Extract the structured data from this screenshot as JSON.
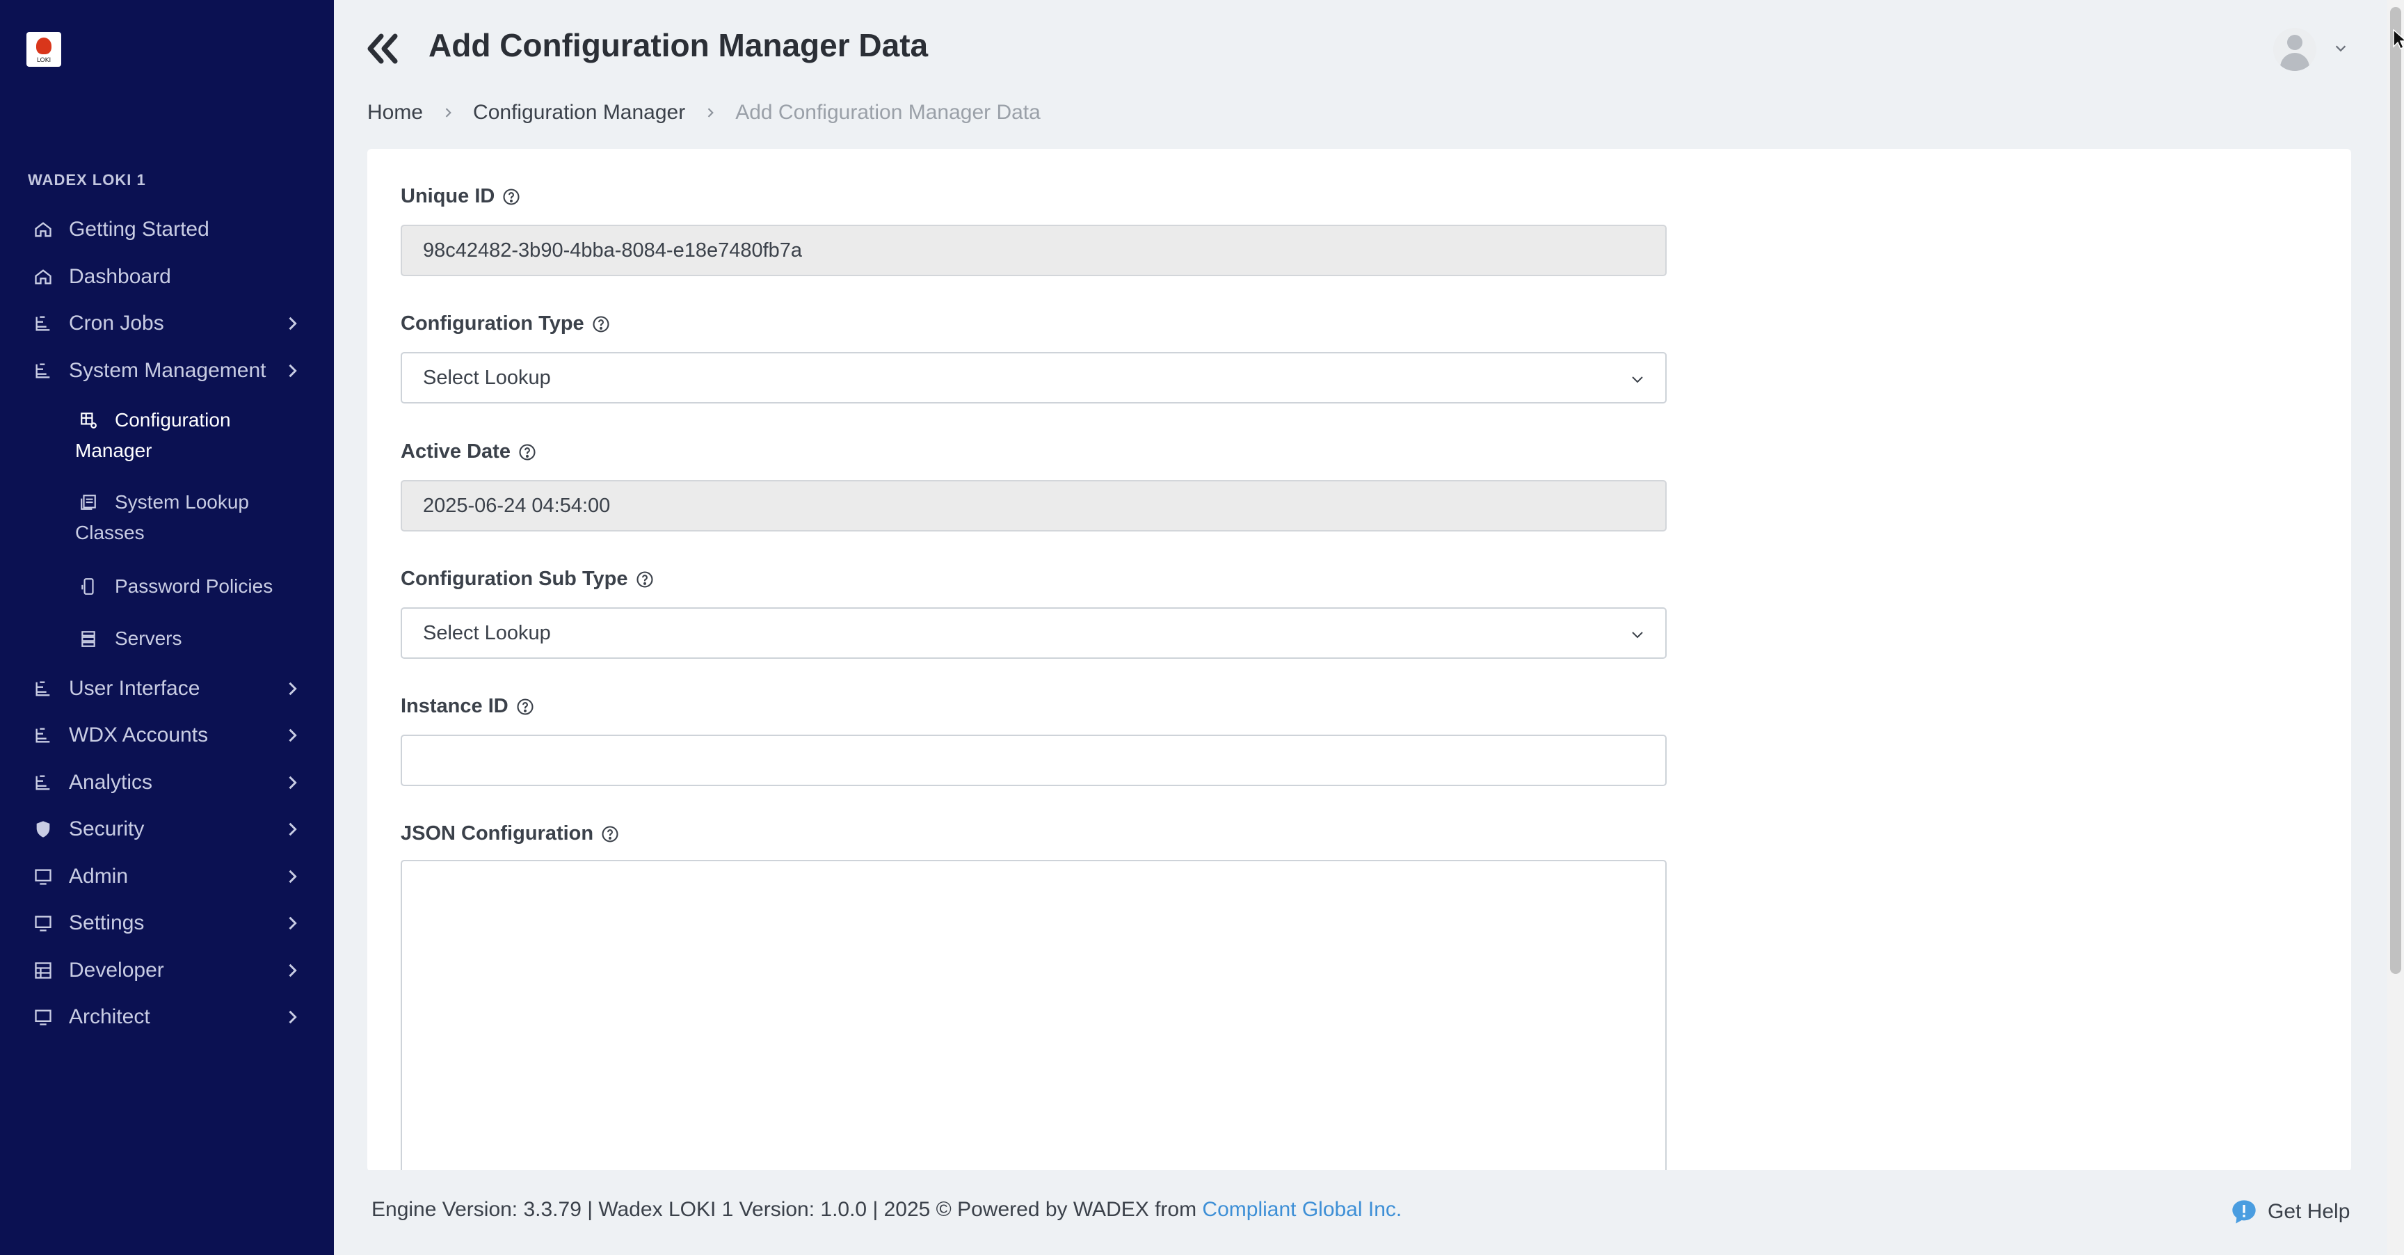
{
  "app": {
    "logo_text": "LOKI",
    "org_label": "WADEX LOKI 1"
  },
  "sidebar": {
    "items": [
      {
        "label": "Getting Started",
        "icon": "home-icon"
      },
      {
        "label": "Dashboard",
        "icon": "home-icon"
      },
      {
        "label": "Cron Jobs",
        "icon": "tree-icon"
      },
      {
        "label": "System Management",
        "icon": "tree-icon"
      },
      {
        "label": "User Interface",
        "icon": "tree-icon"
      },
      {
        "label": "WDX Accounts",
        "icon": "tree-icon"
      },
      {
        "label": "Analytics",
        "icon": "tree-icon"
      },
      {
        "label": "Security",
        "icon": "shield-icon"
      },
      {
        "label": "Admin",
        "icon": "monitor-icon"
      },
      {
        "label": "Settings",
        "icon": "monitor-icon"
      },
      {
        "label": "Developer",
        "icon": "grid-icon"
      },
      {
        "label": "Architect",
        "icon": "monitor-icon"
      }
    ],
    "sub_items": [
      {
        "line1": "Configuration",
        "line2": "Manager",
        "icon": "config-icon",
        "active": true
      },
      {
        "line1": "System Lookup",
        "line2": "Classes",
        "icon": "list-icon"
      },
      {
        "line1": "Password Policies",
        "line2": "",
        "icon": "phone-icon"
      },
      {
        "line1": "Servers",
        "line2": "",
        "icon": "server-icon"
      }
    ]
  },
  "header": {
    "title": "Add Configuration Manager Data"
  },
  "breadcrumb": [
    "Home",
    "Configuration Manager",
    "Add Configuration Manager Data"
  ],
  "form": {
    "unique_id": {
      "label": "Unique ID",
      "value": "98c42482-3b90-4bba-8084-e18e7480fb7a"
    },
    "config_type": {
      "label": "Configuration Type",
      "value": "Select Lookup"
    },
    "active_date": {
      "label": "Active Date",
      "value": "2025-06-24 04:54:00"
    },
    "config_sub_type": {
      "label": "Configuration Sub Type",
      "value": "Select Lookup"
    },
    "instance_id": {
      "label": "Instance ID",
      "value": ""
    },
    "json_config": {
      "label": "JSON Configuration",
      "value": ""
    }
  },
  "footer": {
    "text": "Engine Version: 3.3.79 | Wadex LOKI 1 Version: 1.0.0 | 2025 © Powered by WADEX from ",
    "link": "Compliant Global Inc.",
    "help": "Get Help"
  },
  "colors": {
    "sidebar_bg": "#0b1152",
    "link": "#3d8fd6",
    "help_icon": "#4a9de0"
  }
}
